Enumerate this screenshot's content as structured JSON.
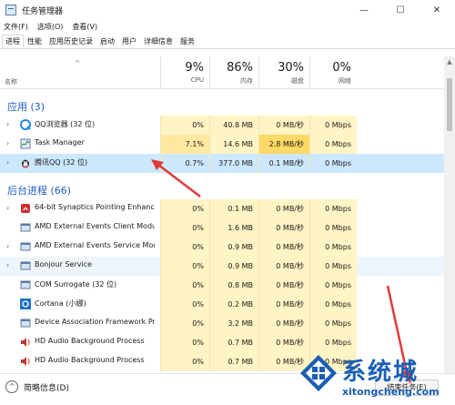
{
  "window": {
    "title": "任务管理器",
    "controls": {
      "minimize": "—",
      "maximize": "☐",
      "close": "✕"
    }
  },
  "menu": [
    "文件(F)",
    "选项(O)",
    "查看(V)"
  ],
  "tabs": [
    "进程",
    "性能",
    "应用历史记录",
    "启动",
    "用户",
    "详细信息",
    "服务"
  ],
  "active_tab": "进程",
  "header": {
    "name_label": "名称",
    "columns": [
      {
        "pct": "9%",
        "label": "CPU"
      },
      {
        "pct": "86%",
        "label": "内存"
      },
      {
        "pct": "30%",
        "label": "磁盘"
      },
      {
        "pct": "0%",
        "label": "网络"
      }
    ]
  },
  "sections": {
    "apps": "应用 (3)",
    "background": "后台进程 (66)"
  },
  "apps": [
    {
      "name": "QQ浏览器 (32 位)",
      "icon": "qq-browser-icon",
      "cpu": "0%",
      "mem": "40.8 MB",
      "disk": "0 MB/秒",
      "net": "0 Mbps",
      "expand": "›"
    },
    {
      "name": "Task Manager",
      "icon": "task-manager-icon",
      "cpu": "7.1%",
      "mem": "14.6 MB",
      "disk": "2.8 MB/秒",
      "net": "0 Mbps",
      "expand": "›"
    },
    {
      "name": "腾讯QQ (32 位)",
      "icon": "qq-penguin-icon",
      "cpu": "0.7%",
      "mem": "377.0 MB",
      "disk": "0.1 MB/秒",
      "net": "0 Mbps",
      "expand": "›"
    }
  ],
  "background": [
    {
      "name": "64-bit Synaptics Pointing Enhance...",
      "icon": "synaptics-icon",
      "cpu": "0%",
      "mem": "0.1 MB",
      "disk": "0 MB/秒",
      "net": "0 Mbps",
      "expand": "›"
    },
    {
      "name": "AMD External Events Client Module",
      "icon": "service-icon",
      "cpu": "0%",
      "mem": "1.6 MB",
      "disk": "0 MB/秒",
      "net": "0 Mbps",
      "expand": ""
    },
    {
      "name": "AMD External Events Service Mod...",
      "icon": "service-icon",
      "cpu": "0%",
      "mem": "0.9 MB",
      "disk": "0 MB/秒",
      "net": "0 Mbps",
      "expand": "›"
    },
    {
      "name": "Bonjour Service",
      "icon": "service-icon",
      "cpu": "0%",
      "mem": "0.9 MB",
      "disk": "0 MB/秒",
      "net": "0 Mbps",
      "expand": "›"
    },
    {
      "name": "COM Surrogate (32 位)",
      "icon": "service-icon",
      "cpu": "0%",
      "mem": "0.8 MB",
      "disk": "0 MB/秒",
      "net": "0 Mbps",
      "expand": ""
    },
    {
      "name": "Cortana (小娜)",
      "icon": "cortana-icon",
      "cpu": "0%",
      "mem": "0.2 MB",
      "disk": "0 MB/秒",
      "net": "0 Mbps",
      "expand": ""
    },
    {
      "name": "Device Association Framework Pro...",
      "icon": "service-icon",
      "cpu": "0%",
      "mem": "3.2 MB",
      "disk": "0 MB/秒",
      "net": "0 Mbps",
      "expand": ""
    },
    {
      "name": "HD Audio Background Process",
      "icon": "speaker-icon",
      "cpu": "0%",
      "mem": "0.7 MB",
      "disk": "0 MB/秒",
      "net": "0 Mbps",
      "expand": ""
    },
    {
      "name": "HD Audio Background Process",
      "icon": "speaker-icon",
      "cpu": "0%",
      "mem": "0.7 MB",
      "disk": "0 MB/秒",
      "net": "0 Mbps",
      "expand": ""
    }
  ],
  "footer": {
    "fewer_details": "简略信息(D)",
    "end_task": "结束任务(E)"
  },
  "watermark": {
    "brand": "系统城",
    "url": "xitongcheng.com"
  },
  "colors": {
    "accent": "#1f5fbf",
    "heat_light": "#fff4c4",
    "heat_medium": "#ffe9a0",
    "selected": "#cce8ff",
    "annotation_arrow": "#e03a3a"
  }
}
